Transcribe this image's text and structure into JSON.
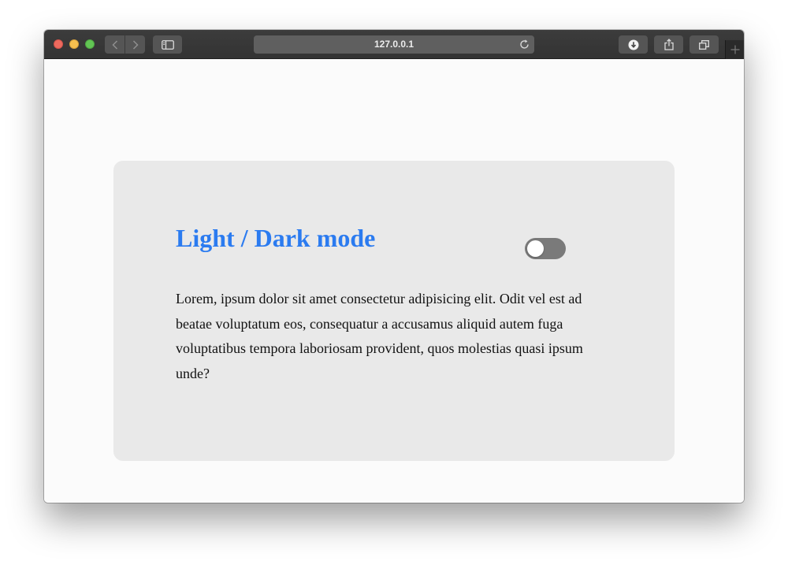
{
  "browser": {
    "address": "127.0.0.1",
    "icons": {
      "back": "chevron-left-icon",
      "forward": "chevron-right-icon",
      "sidebar": "sidebar-icon",
      "reload": "reload-icon",
      "download": "download-icon",
      "share": "share-icon",
      "tabs": "tabs-overview-icon",
      "new_tab": "plus-icon"
    }
  },
  "card": {
    "title": "Light / Dark mode",
    "body": "Lorem, ipsum dolor sit amet consectetur adipisicing elit. Odit vel est ad beatae voluptatum eos, consequatur a accusamus aliquid autem fuga voluptatibus tempora laboriosam provident, quos molestias quasi ipsum unde?",
    "toggle": {
      "state": "off"
    }
  },
  "colors": {
    "title": "#2b7bf0",
    "card_background": "#e9e9e9",
    "page_background": "#fbfbfb",
    "toggle_track": "#7a7a7a",
    "toggle_knob": "#ffffff"
  }
}
